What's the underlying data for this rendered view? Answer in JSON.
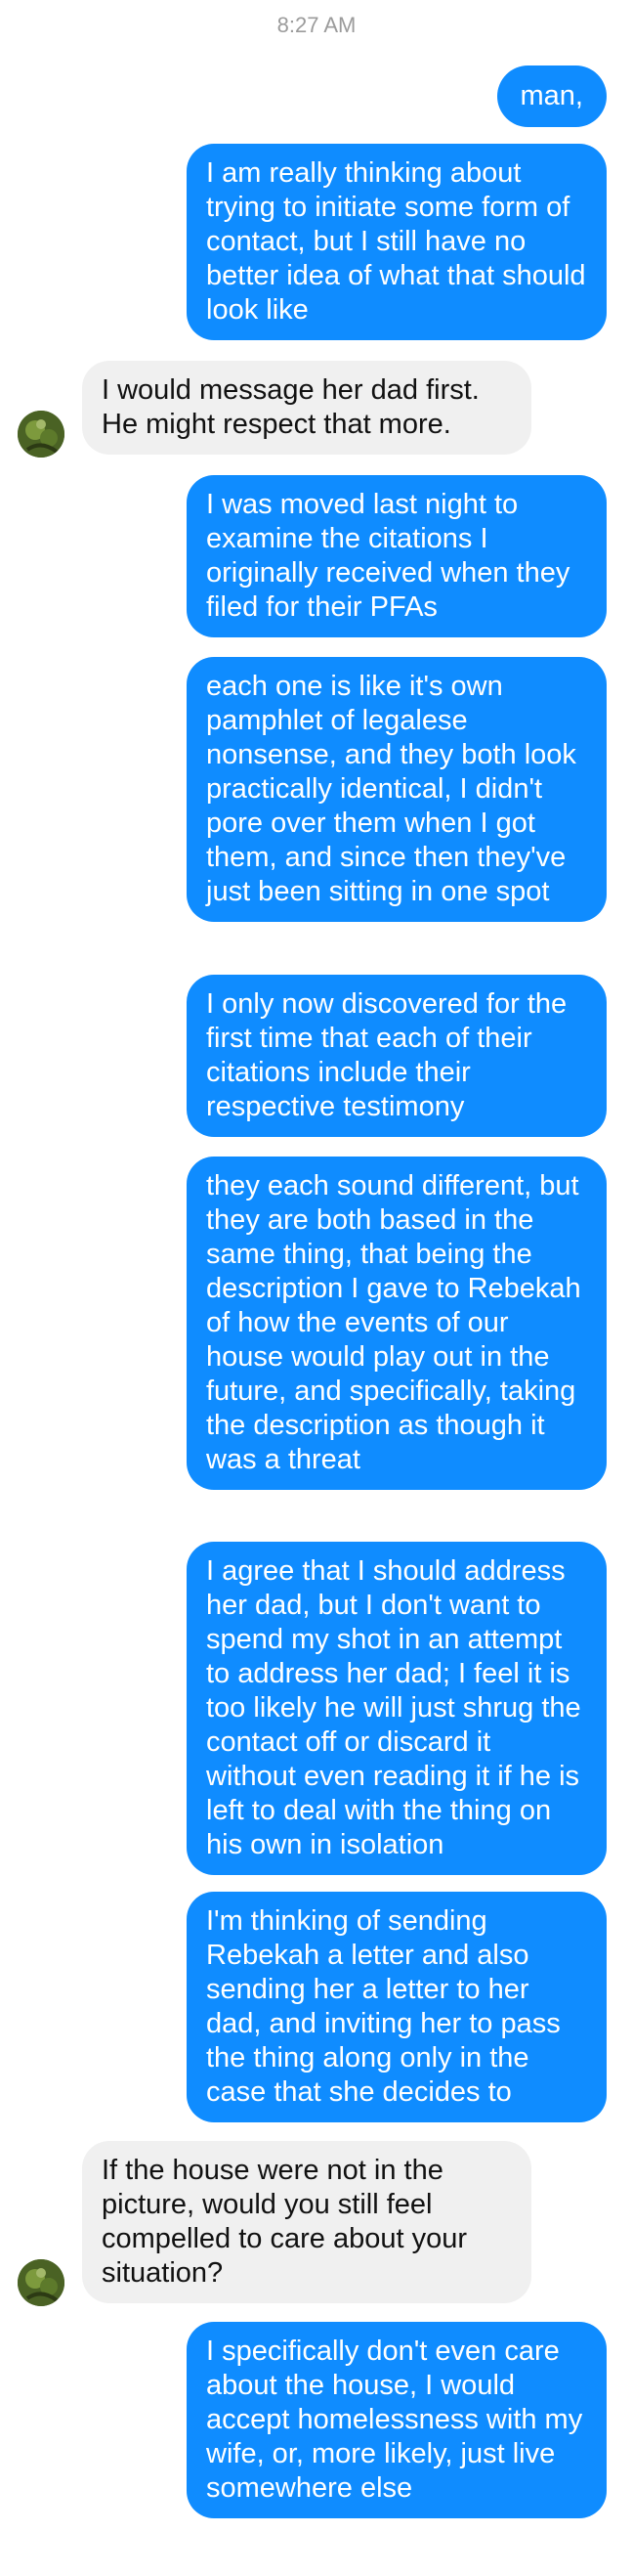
{
  "timestamp": "8:27 AM",
  "messages": [
    {
      "from": "me",
      "text": "man,"
    },
    {
      "from": "me",
      "text": "I am really thinking about trying to initiate some form of contact, but I still have no better idea of what that should look like"
    },
    {
      "from": "them",
      "text": "I would message her dad first. He might respect that more."
    },
    {
      "from": "me",
      "text": "I was moved last night to examine the citations I originally received when they filed for their PFAs"
    },
    {
      "from": "me",
      "text": "each one is like it's own pamphlet of legalese nonsense, and they both look practically identical, I didn't pore over them when I got them, and since then they've just been sitting in one spot"
    },
    {
      "from": "me",
      "text": "I only now discovered for the first time that each of their citations include their respective testimony"
    },
    {
      "from": "me",
      "text": "they each sound different, but they are both based in the same thing, that being the description I gave to Rebekah of how the events of our house would play out in the future, and specifically, taking the description as though it was a threat"
    },
    {
      "from": "me",
      "text": "I agree that I should address her dad, but I don't want to spend my shot in an attempt to address her dad; I feel it is too likely he will just shrug the contact off or discard it without even reading it if he is left to deal with the thing on his own in isolation"
    },
    {
      "from": "me",
      "text": "I'm thinking of sending Rebekah a letter and also sending her a letter to her dad, and inviting her to pass the thing along only in the case that she decides to"
    },
    {
      "from": "them",
      "text": "If the house were not in the picture, would you still feel compelled to care about your situation?"
    },
    {
      "from": "me",
      "text": "I specifically don't even care about the house, I would accept homelessness with my wife, or, more likely, just live somewhere else"
    }
  ]
}
